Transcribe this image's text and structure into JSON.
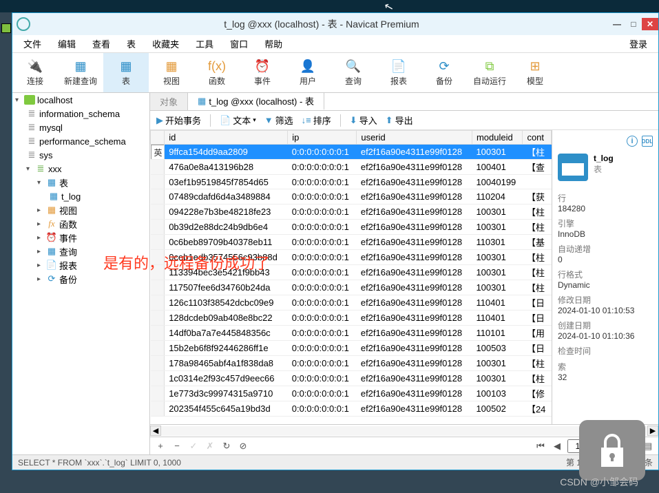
{
  "window": {
    "title": "t_log @xxx (localhost) - 表 - Navicat Premium"
  },
  "winbtns": {
    "min": "—",
    "max": "□",
    "close": "✕"
  },
  "menu": [
    "文件",
    "编辑",
    "查看",
    "表",
    "收藏夹",
    "工具",
    "窗口",
    "帮助"
  ],
  "login": "登录",
  "toolbar": [
    {
      "label": "连接",
      "icon": "🔌"
    },
    {
      "label": "新建查询",
      "icon": "▦"
    },
    {
      "label": "表",
      "icon": "▦",
      "active": true
    },
    {
      "label": "视图",
      "icon": "▦"
    },
    {
      "label": "函数",
      "icon": "f(x)"
    },
    {
      "label": "事件",
      "icon": "⏰"
    },
    {
      "label": "用户",
      "icon": "👤"
    },
    {
      "label": "查询",
      "icon": "🔍"
    },
    {
      "label": "报表",
      "icon": "📄"
    },
    {
      "label": "备份",
      "icon": "⟳"
    },
    {
      "label": "自动运行",
      "icon": "⧉"
    },
    {
      "label": "模型",
      "icon": "⊞"
    }
  ],
  "tree": {
    "root": "localhost",
    "dbs": [
      "information_schema",
      "mysql",
      "performance_schema",
      "sys",
      "xxx"
    ],
    "xxx_children": [
      {
        "l": "表",
        "children": [
          "t_log"
        ]
      },
      {
        "l": "视图"
      },
      {
        "l": "函数"
      },
      {
        "l": "事件"
      },
      {
        "l": "查询"
      },
      {
        "l": "报表"
      },
      {
        "l": "备份"
      }
    ]
  },
  "tabs": {
    "obj": "对象",
    "active": "t_log @xxx (localhost) - 表"
  },
  "toolbar2": {
    "begin": "开始事务",
    "text": "文本",
    "filter": "筛选",
    "sort": "排序",
    "import": "导入",
    "export": "导出"
  },
  "columns": [
    "id",
    "ip",
    "userid",
    "moduleid",
    "cont"
  ],
  "rows": [
    {
      "id": "9ffca154dd9aa2809",
      "ip": "0:0:0:0:0:0:0:1",
      "userid": "ef2f16a90e4311e99f0128",
      "moduleid": "100301",
      "cont": "【柱"
    },
    {
      "id": "476a0e8a413196b28",
      "ip": "0:0:0:0:0:0:0:1",
      "userid": "ef2f16a90e4311e99f0128",
      "moduleid": "100401",
      "cont": "【查"
    },
    {
      "id": "03ef1b9519845f7854d65",
      "ip": "0:0:0:0:0:0:0:1",
      "userid": "ef2f16a90e4311e99f0128",
      "moduleid": "10040199",
      "cont": ""
    },
    {
      "id": "07489cdafd6d4a3489884",
      "ip": "0:0:0:0:0:0:0:1",
      "userid": "ef2f16a90e4311e99f0128",
      "moduleid": "110204",
      "cont": "【获"
    },
    {
      "id": "094228e7b3be48218fe23",
      "ip": "0:0:0:0:0:0:0:1",
      "userid": "ef2f16a90e4311e99f0128",
      "moduleid": "100301",
      "cont": "【柱"
    },
    {
      "id": "0b39d2e88dc24b9db6e4",
      "ip": "0:0:0:0:0:0:0:1",
      "userid": "ef2f16a90e4311e99f0128",
      "moduleid": "100301",
      "cont": "【柱"
    },
    {
      "id": "0c6beb89709b40378eb11",
      "ip": "0:0:0:0:0:0:0:1",
      "userid": "ef2f16a90e4311e99f0128",
      "moduleid": "110301",
      "cont": "【基"
    },
    {
      "id": "0ceb1edb3574556c93b88d",
      "ip": "0:0:0:0:0:0:0:1",
      "userid": "ef2f16a90e4311e99f0128",
      "moduleid": "100301",
      "cont": "【柱"
    },
    {
      "id": "113394bec3e5421f9bb43",
      "ip": "0:0:0:0:0:0:0:1",
      "userid": "ef2f16a90e4311e99f0128",
      "moduleid": "100301",
      "cont": "【柱"
    },
    {
      "id": "117507fee6d34760b24da",
      "ip": "0:0:0:0:0:0:0:1",
      "userid": "ef2f16a90e4311e99f0128",
      "moduleid": "100301",
      "cont": "【柱"
    },
    {
      "id": "126c1103f38542dcbc09e9",
      "ip": "0:0:0:0:0:0:0:1",
      "userid": "ef2f16a90e4311e99f0128",
      "moduleid": "110401",
      "cont": "【日"
    },
    {
      "id": "128dcdeb09ab408e8bc22",
      "ip": "0:0:0:0:0:0:0:1",
      "userid": "ef2f16a90e4311e99f0128",
      "moduleid": "110401",
      "cont": "【日"
    },
    {
      "id": "14df0ba7a7e445848356c",
      "ip": "0:0:0:0:0:0:0:1",
      "userid": "ef2f16a90e4311e99f0128",
      "moduleid": "110101",
      "cont": "【用"
    },
    {
      "id": "15b2eb6f8f92446286ff1e",
      "ip": "0:0:0:0:0:0:0:1",
      "userid": "ef2f16a90e4311e99f0128",
      "moduleid": "100503",
      "cont": "【日"
    },
    {
      "id": "178a98465abf4a1f838da8",
      "ip": "0:0:0:0:0:0:0:1",
      "userid": "ef2f16a90e4311e99f0128",
      "moduleid": "100301",
      "cont": "【柱"
    },
    {
      "id": "1c0314e2f93c457d9eec66",
      "ip": "0:0:0:0:0:0:0:1",
      "userid": "ef2f16a90e4311e99f0128",
      "moduleid": "100301",
      "cont": "【柱"
    },
    {
      "id": "1e773d3c99974315a9710",
      "ip": "0:0:0:0:0:0:0:1",
      "userid": "ef2f16a90e4311e99f0128",
      "moduleid": "100103",
      "cont": "【修"
    },
    {
      "id": "202354f455c645a19bd3d",
      "ip": "0:0:0:0:0:0:0:1",
      "userid": "ef2f16a90e4311e99f0128",
      "moduleid": "100502",
      "cont": "【24"
    }
  ],
  "ime": "英",
  "inspector": {
    "name": "t_log",
    "type": "表",
    "props": [
      {
        "l": "行",
        "v": "184280"
      },
      {
        "l": "引擎",
        "v": "InnoDB"
      },
      {
        "l": "自动递增",
        "v": "0"
      },
      {
        "l": "行格式",
        "v": "Dynamic"
      },
      {
        "l": "修改日期",
        "v": "2024-01-10 01:10:53"
      },
      {
        "l": "创建日期",
        "v": "2024-01-10 01:10:36"
      },
      {
        "l": "检查时间",
        "v": ""
      },
      {
        "l": "索",
        "v": "32"
      }
    ]
  },
  "nav": {
    "page": "1"
  },
  "status": {
    "sql": "SELECT * FROM `xxx`.`t_log` LIMIT 0, 1000",
    "info": "第 1 条记录 (共 1000 条"
  },
  "overlay": "是有的，远程备份成功了",
  "watermark": "CSDN @小邹会码"
}
